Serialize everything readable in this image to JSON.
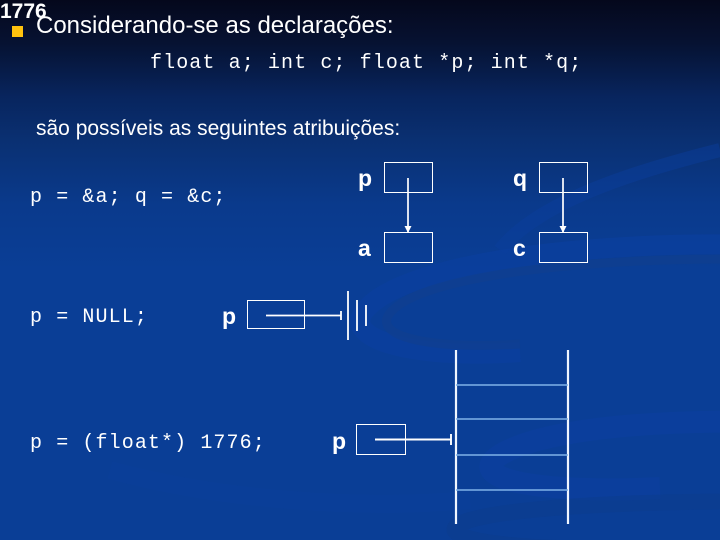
{
  "slide": {
    "bullet_icon": "bullet-square-icon",
    "title": "Considerando-se as declarações:",
    "declaration": "float a; int c; float *p; int *q;",
    "subtitle": "são possíveis as seguintes atribuições:",
    "accent_color": "#ffc20e",
    "background_color": "#0a3e96",
    "line_color": "#ffffff"
  },
  "rows": [
    {
      "code": "p = &a; q = &c;",
      "diagrams": [
        {
          "pointer_label": "p",
          "target_label": "a",
          "kind": "points-to"
        },
        {
          "pointer_label": "q",
          "target_label": "c",
          "kind": "points-to"
        }
      ]
    },
    {
      "code": "p = NULL;",
      "diagrams": [
        {
          "pointer_label": "p",
          "kind": "null-ground"
        }
      ]
    },
    {
      "code": "p = (float*) 1776;",
      "diagrams": [
        {
          "pointer_label": "p",
          "kind": "memory-address",
          "address": "1776"
        }
      ]
    }
  ],
  "memory": {
    "address_label": "1776",
    "slot_count": 5
  }
}
